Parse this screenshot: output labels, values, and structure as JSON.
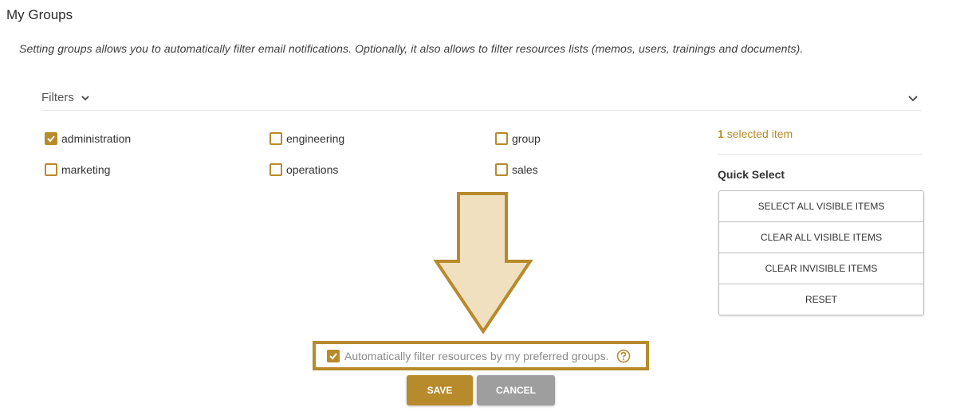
{
  "page": {
    "title": "My Groups",
    "description": "Setting groups allows you to automatically filter email notifications. Optionally, it also allows to filter resources lists (memos, users, trainings and documents)."
  },
  "filters": {
    "label": "Filters",
    "options": [
      {
        "label": "administration",
        "checked": true
      },
      {
        "label": "engineering",
        "checked": false
      },
      {
        "label": "group",
        "checked": false
      },
      {
        "label": "marketing",
        "checked": false
      },
      {
        "label": "operations",
        "checked": false
      },
      {
        "label": "sales",
        "checked": false
      }
    ]
  },
  "selection": {
    "count": "1",
    "suffix": "selected item"
  },
  "quick_select": {
    "title": "Quick Select",
    "buttons": [
      "SELECT ALL VISIBLE ITEMS",
      "CLEAR ALL VISIBLE ITEMS",
      "CLEAR INVISIBLE ITEMS",
      "RESET"
    ]
  },
  "auto_filter": {
    "label": "Automatically filter resources by my preferred groups.",
    "checked": true
  },
  "actions": {
    "save": "SAVE",
    "cancel": "CANCEL"
  },
  "colors": {
    "accent": "#b78a2c",
    "arrow_fill": "#f0e0c0",
    "cancel": "#9e9e9e"
  },
  "icons": {
    "check": "check-icon",
    "chevron": "chevron-down-icon",
    "help": "help-circle-icon",
    "arrow": "down-arrow-annotation"
  }
}
